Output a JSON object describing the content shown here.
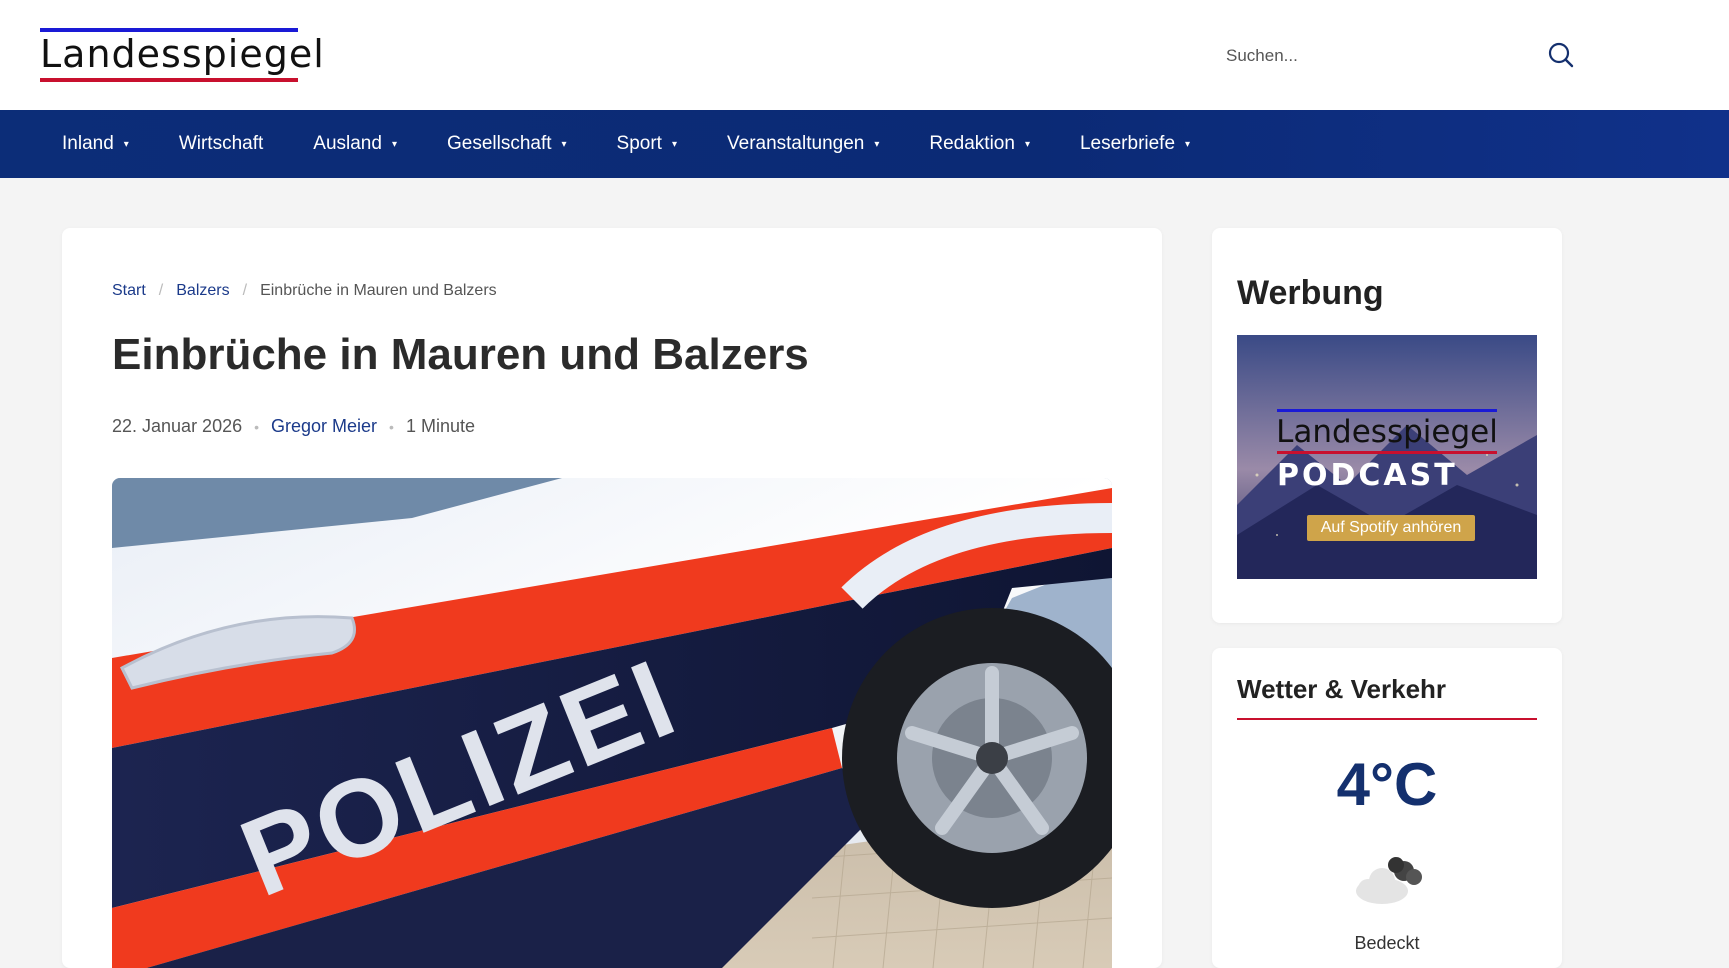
{
  "header": {
    "logo_text": "Landesspiegel",
    "search_placeholder": "Suchen..."
  },
  "nav": [
    {
      "label": "Inland",
      "has_dropdown": true
    },
    {
      "label": "Wirtschaft",
      "has_dropdown": false
    },
    {
      "label": "Ausland",
      "has_dropdown": true
    },
    {
      "label": "Gesellschaft",
      "has_dropdown": true
    },
    {
      "label": "Sport",
      "has_dropdown": true
    },
    {
      "label": "Veranstaltungen",
      "has_dropdown": true
    },
    {
      "label": "Redaktion",
      "has_dropdown": true
    },
    {
      "label": "Leserbriefe",
      "has_dropdown": true
    }
  ],
  "caret": "▾",
  "breadcrumb": {
    "home": "Start",
    "category": "Balzers",
    "current": "Einbrüche in Mauren und Balzers",
    "separator": "/"
  },
  "article": {
    "title": "Einbrüche in Mauren und Balzers",
    "date": "22. Januar 2026",
    "author": "Gregor Meier",
    "reading_time": "1 Minute",
    "meta_separator": "•",
    "image_text": "POLIZEI"
  },
  "sidebar": {
    "ad": {
      "heading": "Werbung",
      "banner_logo": "Landesspiegel",
      "banner_title": "PODCAST",
      "banner_cta": "Auf Spotify anhören"
    },
    "weather": {
      "heading": "Wetter & Verkehr",
      "temperature": "4°C",
      "icon": "cloud-icon",
      "description": "Bedeckt"
    }
  },
  "colors": {
    "nav_bg": "#0b2a75",
    "accent_red": "#c8102e",
    "logo_blue": "#1a1ad6",
    "link_blue": "#1b3a8a",
    "temp_color": "#14306e"
  }
}
